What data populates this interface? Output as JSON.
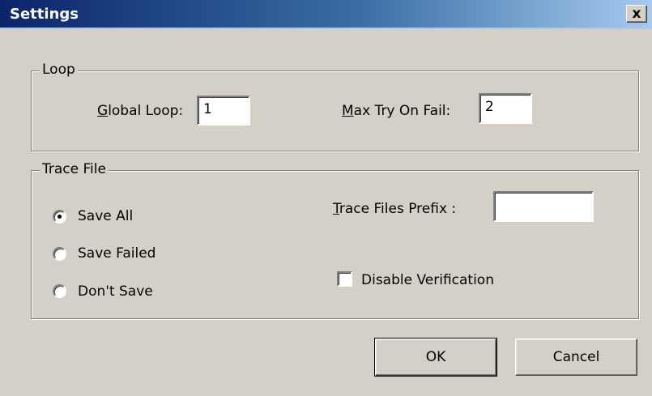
{
  "window": {
    "title": "Settings",
    "close_label": "x"
  },
  "loop": {
    "group_label": "Loop",
    "global_loop_underlined": "G",
    "global_loop_rest": "lobal Loop:",
    "global_loop_value": "1",
    "max_try_underlined": "M",
    "max_try_rest": "ax Try On Fail:",
    "max_try_value": "2"
  },
  "trace": {
    "group_label": "Trace File",
    "radio_options": [
      {
        "label": "Save All",
        "selected": true
      },
      {
        "label": "Save Failed",
        "selected": false
      },
      {
        "label": "Don't Save",
        "selected": false
      }
    ],
    "prefix_underlined": "T",
    "prefix_rest": "race Files  Prefix :",
    "prefix_value": "",
    "disable_verification_label": "Disable Verification",
    "disable_verification_checked": false
  },
  "buttons": {
    "ok": "OK",
    "cancel": "Cancel"
  }
}
